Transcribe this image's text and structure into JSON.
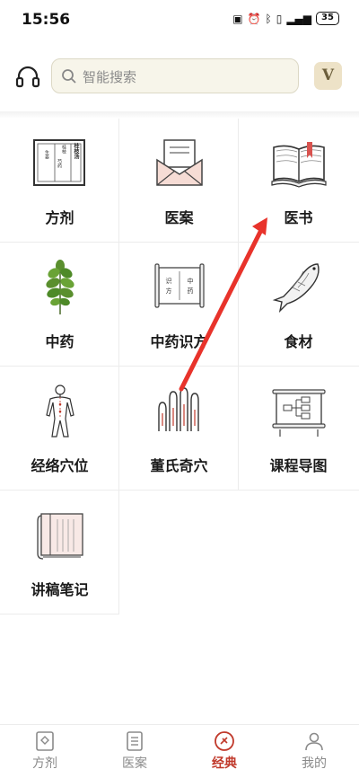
{
  "status_bar": {
    "time": "15:56",
    "battery": "35"
  },
  "header": {
    "search_placeholder": "智能搜索",
    "vip_letter": "V"
  },
  "grid": {
    "items": [
      {
        "label": "方剂",
        "icon": "book-cover-icon"
      },
      {
        "label": "医案",
        "icon": "envelope-icon"
      },
      {
        "label": "医书",
        "icon": "open-book-icon"
      },
      {
        "label": "中药",
        "icon": "herb-leaves-icon"
      },
      {
        "label": "中药识方",
        "icon": "scroll-icon"
      },
      {
        "label": "食材",
        "icon": "fish-icon"
      },
      {
        "label": "经络穴位",
        "icon": "body-meridian-icon"
      },
      {
        "label": "董氏奇穴",
        "icon": "fingers-icon"
      },
      {
        "label": "课程导图",
        "icon": "flowchart-scroll-icon"
      },
      {
        "label": "讲稿笔记",
        "icon": "notebook-icon"
      }
    ],
    "book_cover_texts": {
      "title": "桂枝汤",
      "line1": "桂枝",
      "line2": "芍药",
      "line3": "生姜"
    },
    "scroll_texts": {
      "a": "识",
      "b": "方",
      "c": "中",
      "d": "药"
    }
  },
  "bottom_nav": {
    "items": [
      {
        "label": "方剂",
        "icon": "formula-icon"
      },
      {
        "label": "医案",
        "icon": "document-icon"
      },
      {
        "label": "经典",
        "icon": "classic-icon",
        "active": true
      },
      {
        "label": "我的",
        "icon": "person-icon"
      }
    ]
  },
  "colors": {
    "accent": "#c0392b",
    "annotation_arrow": "#e8332b",
    "search_bg": "#f7f5ea"
  }
}
